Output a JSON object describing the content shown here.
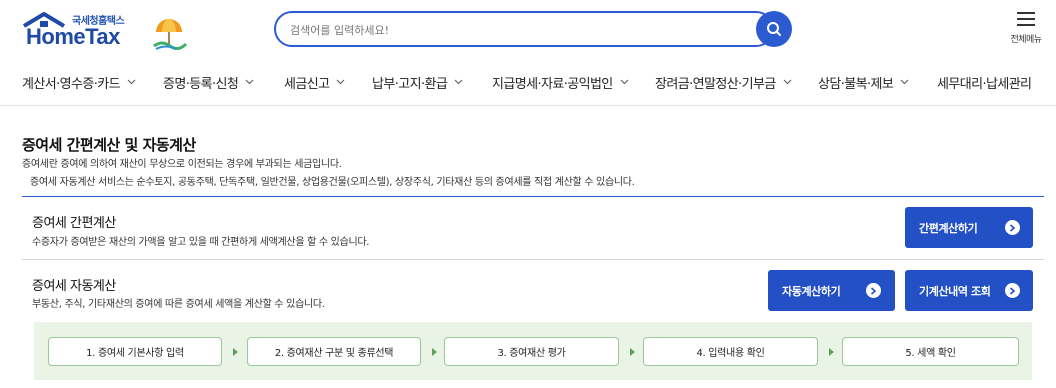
{
  "header": {
    "logo_sub": "국세청홈택스",
    "logo_main": "HomeTax",
    "search_placeholder": "검색어를 입력하세요!",
    "allmenu_label": "전체메뉴"
  },
  "gnb": [
    {
      "label": "계산서·영수증·카드"
    },
    {
      "label": "증명·등록·신청"
    },
    {
      "label": "세금신고"
    },
    {
      "label": "납부·고지·환급"
    },
    {
      "label": "지급명세·자료·공익법인"
    },
    {
      "label": "장려금·연말정산·기부금"
    },
    {
      "label": "상담·불복·제보"
    },
    {
      "label": "세무대리·납세관리"
    }
  ],
  "content": {
    "title": "증여세 간편계산 및 자동계산",
    "desc1": "증여세란 증여에 의하여 재산이 무상으로 이전되는 경우에 부과되는 세금입니다.",
    "desc2": "증여세 자동계산 서비스는 순수토지, 공동주택, 단독주택, 일반건물, 상업용건물(오피스텔), 상장주식, 기타재산 등의 증여세를 직접 계산할 수 있습니다."
  },
  "simple": {
    "title": "증여세 간편계산",
    "desc": "수증자가 증여받은 재산의 가액을 알고 있을 때 간편하게 세액계산을 할 수 있습니다.",
    "button": "간편계산하기"
  },
  "auto": {
    "title": "증여세 자동계산",
    "desc": "부동산, 주식, 기타재산의 증여에 따른 증여세 세액을 계산할 수 있습니다.",
    "button_auto": "자동계산하기",
    "button_history": "기계산내역 조회"
  },
  "steps": [
    {
      "label": "1. 증여세 기본사항 입력"
    },
    {
      "label": "2. 증여재산 구분 및 종류선택"
    },
    {
      "label": "3. 증여재산 평가"
    },
    {
      "label": "4. 입력내용 확인"
    },
    {
      "label": "5. 세액 확인"
    }
  ],
  "colors": {
    "primary": "#2450c6",
    "search_border": "#2c5bd1",
    "steps_bg": "#eaf4e6",
    "step_border": "#9bc79a"
  },
  "icons": {
    "search": "search-icon",
    "menu": "hamburger-icon",
    "chevron": "chevron-down-icon",
    "arrow": "arrow-right-circle-icon"
  }
}
